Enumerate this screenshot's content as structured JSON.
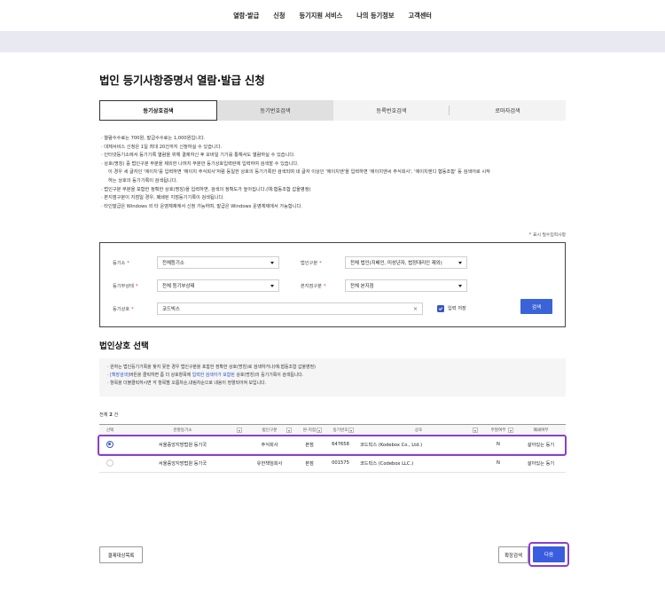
{
  "nav": [
    "열람·발급",
    "신청",
    "등기지원 서비스",
    "나의 등기정보",
    "고객센터"
  ],
  "page_title": "법인 등기사항증명서 열람·발급 신청",
  "tabs": [
    {
      "label": "등기상호검색",
      "state": "active"
    },
    {
      "label": "등기번호검색",
      "state": "gray"
    },
    {
      "label": "등록번호검색",
      "state": "normal"
    },
    {
      "label": "로마자검색",
      "state": "normal"
    }
  ],
  "notices": [
    "· 열람수수료는 700원, 발급수수료는 1,000원입니다.",
    "· 대체서비스 신청은 1일 최대 20건까지 신청하실 수 있습니다.",
    "· 인터넷등기소에서 등기기록 열람을 위해 결제하신 후 모바일 기기를 통해서도 열람하실 수 있습니다.",
    "· 상호(명칭) 중 법인구분 부분을 제외한 나머지 부분만 등기상호입력란에 입력하여 검색할 수 있습니다.",
    "이 경우 세 글자인 '에이치'를 입력하면 '에이치 주식회사'처럼 등일한 상호의 등기기록만 검색되며 네 글자 이상인 '에이치엔'을 입력하면 '에이치엔씨 주식회사', '에이치엔디 협동조합' 등 검색어로 시작",
    "하는 상호의 등기기록이 검색됩니다.",
    "· 법인구분 부분을 포함한 정확한 상호(명칭)을 입력하면, 검색의 정확도가 높아집니다.(예:협동조합 갑울병정)",
    "· 본지점구분이 지점일 경우, 폐쇄된 지점등기기록이 검색됩니다.",
    "· 타인발급은 Windows 외 타 운영체제에서 신청 가능하며, 발급은 Windows 운영체제에서 가능합니다."
  ],
  "required_note": "표시 필수입력사항",
  "required_star": "*",
  "search": {
    "registry_label": "등기소",
    "registry_value": "전체등기소",
    "corp_type_label": "법인구분",
    "corp_type_value": "전체 법인(지배인, 미성년자, 법정대리인 제외)",
    "status_label": "등기부상태",
    "status_value": "전체 등기부상태",
    "branch_label": "본지점구분",
    "branch_value": "전체 본지점",
    "name_label": "등기상호",
    "name_value": "코드빅스",
    "clear_icon": "×",
    "save_input_label": "입력 저장",
    "search_button": "검색",
    "req": "*"
  },
  "section_title": "법인상호 선택",
  "info_lines": [
    {
      "pre": "· 원하는 법인등기기록을 찾지 못한 경우 법인구분을 포함한 정확한 상호(명칭)로 검색하거나(예:협동조합 갑울병정)",
      "blue": "",
      "post": ""
    },
    {
      "pre": "· ",
      "blue": "[확장검색]",
      "mid": "버튼을 클릭하면 좀 더 상호항목에 ",
      "blue2": "입력한 검색어가 포함된",
      "post": " 상호(명칭)의 등기기록이 검색됩니다."
    },
    {
      "pre": "· 항목을 더블클릭하시면 각 항목별 오름차순,내림차순으로 내용이 정렬되어져 보입니다.",
      "blue": "",
      "post": ""
    }
  ],
  "total": {
    "prefix": "전체",
    "count": "2",
    "suffix": "건"
  },
  "table": {
    "headers": [
      "선택",
      "관할등기소",
      "법인구분",
      "본·지점",
      "등기번호",
      "상호",
      "주말여부",
      "폐쇄여부"
    ],
    "rows": [
      {
        "selected": true,
        "office": "서울중앙지방법원 등기국",
        "type": "주식회사",
        "branch": "본점",
        "number": "647658",
        "name": "코드빅스 (Kodebox Co., Ltd.)",
        "weekend": "N",
        "status": "살아있는 등기"
      },
      {
        "selected": false,
        "office": "서울중앙지방법원 등기국",
        "type": "유한책임회사",
        "branch": "본점",
        "number": "001575",
        "name": "코드빅스 (Codebox LLC.)",
        "weekend": "N",
        "status": "살아있는 등기"
      }
    ]
  },
  "buttons": {
    "exclude": "결제대상목록",
    "extended": "확장검색",
    "next": "다음"
  },
  "colors": {
    "accent": "#3a57c4",
    "highlight": "#8a3fd0",
    "banner": "#e8e9f1"
  }
}
